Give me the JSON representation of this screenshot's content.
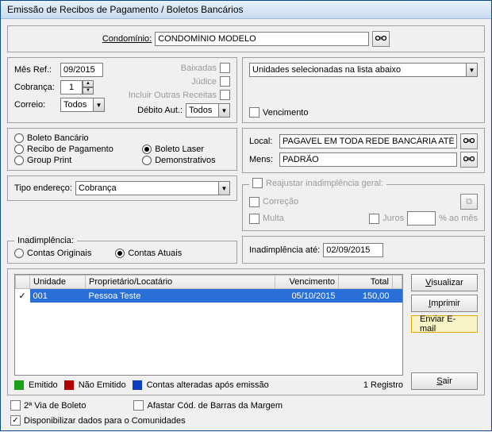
{
  "title": "Emissão de Recibos de Pagamento / Boletos Bancários",
  "condominio": {
    "label": "Condomínio:",
    "value": "CONDOMÍNIO MODELO"
  },
  "topLeft": {
    "mesRefLabel": "Mês Ref.:",
    "mesRefValue": "09/2015",
    "cobrancaLabel": "Cobrança:",
    "cobrancaValue": "1",
    "correioLabel": "Correio:",
    "correioValue": "Todos",
    "chkBaixadas": "Baixadas",
    "chkJudice": "Júdice",
    "chkIncluirOutras": "Incluir Outras Receitas",
    "debAutLabel": "Débito Aut.:",
    "debAutValue": "Todos"
  },
  "topRight": {
    "unidadesSel": "Unidades selecionadas na lista abaixo",
    "chkVencimento": "Vencimento"
  },
  "tipos": {
    "r1": "Boleto Bancário",
    "r2": "Recibo de Pagamento",
    "r3": "Boleto Laser",
    "r4": "Group Print",
    "r5": "Demonstrativos",
    "selected": "r3"
  },
  "localMens": {
    "localLabel": "Local:",
    "localValue": "PAGAVEL EM TODA REDE BANCÁRIA ATÉ O",
    "mensLabel": "Mens:",
    "mensValue": "PADRÃO"
  },
  "reajustar": {
    "legend": "Reajustar inadimplência geral:",
    "chkCorrecao": "Correção",
    "chkMulta": "Multa",
    "jurosLabel": "Juros",
    "jurosValue": "",
    "jurosSuffix": "% ao mês"
  },
  "tipoEndereco": {
    "label": "Tipo endereço:",
    "value": "Cobrança"
  },
  "inad": {
    "legend": "Inadimplência:",
    "r1": "Contas Originais",
    "r2": "Contas Atuais",
    "selected": "r2",
    "ateLabel": "Inadimplência até:",
    "ateValue": "02/09/2015"
  },
  "table": {
    "cols": {
      "c0": "",
      "c1": "Unidade",
      "c2": "Proprietário/Locatário",
      "c3": "Vencimento",
      "c4": "Total"
    },
    "rows": [
      {
        "checked": true,
        "unidade": "001",
        "prop": "Pessoa Teste",
        "venc": "05/10/2015",
        "total": "150,00"
      }
    ]
  },
  "buttons": {
    "visualizar": "Visualizar",
    "imprimir": "Imprimir",
    "enviarEmail": "Enviar E-mail",
    "sair": "Sair"
  },
  "legend": {
    "emitido": "Emitido",
    "naoEmitido": "Não Emitido",
    "alteradas": "Contas alteradas após emissão",
    "count": "1 Registro",
    "colors": {
      "emitido": "#1aa01a",
      "naoEmitido": "#b00000",
      "alteradas": "#103dc0"
    }
  },
  "bottom": {
    "chk2via": "2ª Via de Boleto",
    "chkAfastar": "Afastar Cód. de Barras da Margem",
    "chkDisponibilizar": "Disponibilizar dados para o Comunidades"
  }
}
